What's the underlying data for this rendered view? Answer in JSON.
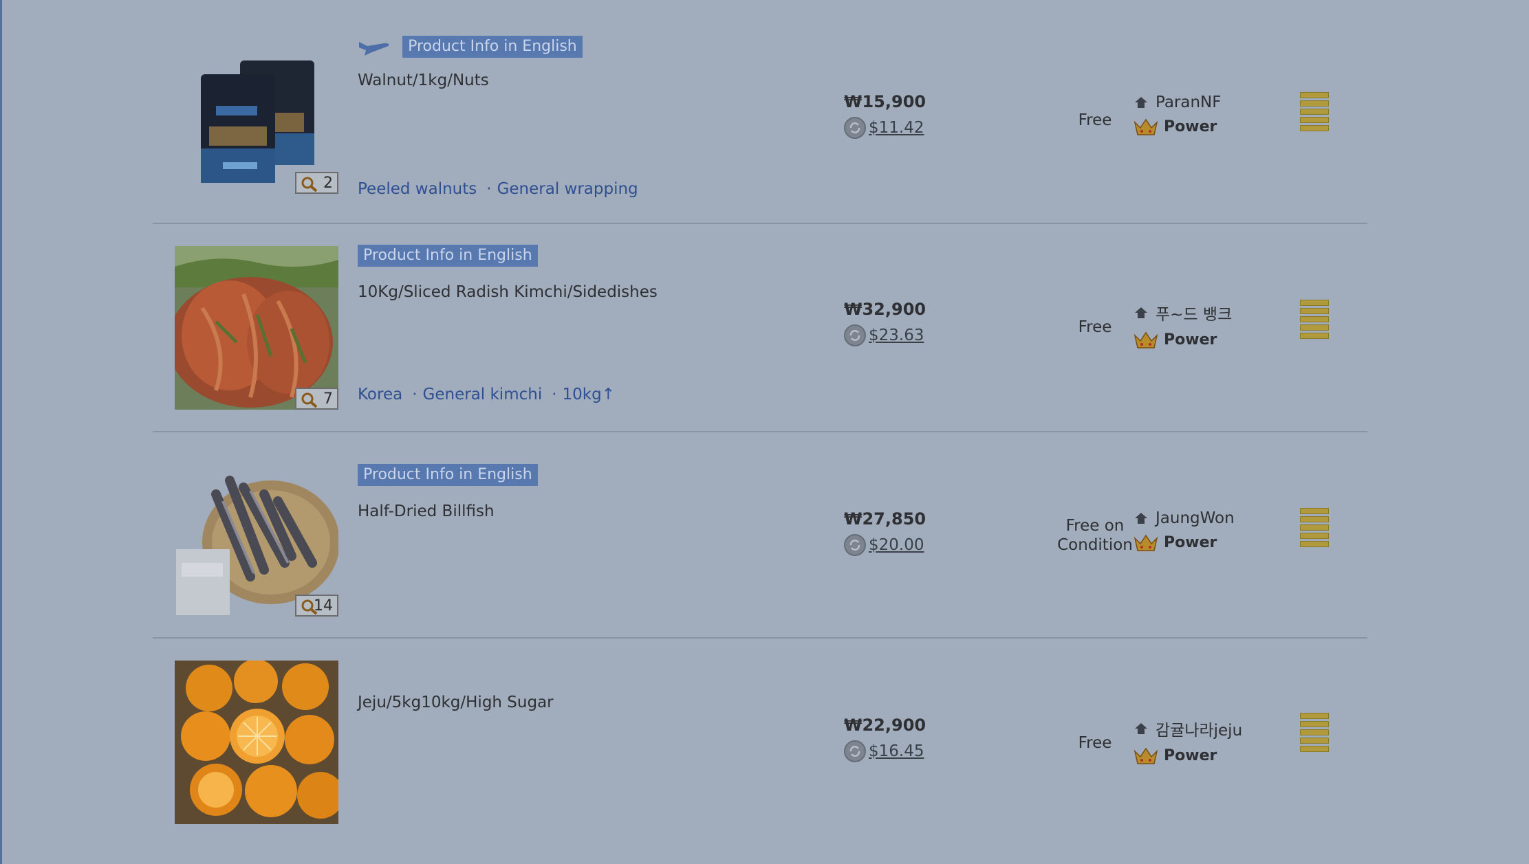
{
  "products": [
    {
      "english_tag": "Product Info in English",
      "has_overseas_icon": true,
      "name": "Walnut/1kg/Nuts",
      "attributes": [
        "Peeled walnuts",
        "General wrapping"
      ],
      "zoom_count": "2",
      "price_krw": "₩15,900",
      "price_usd": "$11.42",
      "shipping": "Free",
      "seller": "ParanNF",
      "seller_grade": "Power"
    },
    {
      "english_tag": "Product Info in English",
      "has_overseas_icon": false,
      "name": "10Kg/Sliced Radish Kimchi/Sidedishes",
      "attributes": [
        "Korea",
        "General kimchi",
        "10kg↑"
      ],
      "zoom_count": "7",
      "price_krw": "₩32,900",
      "price_usd": "$23.63",
      "shipping": "Free",
      "seller": "푸~드 뱅크",
      "seller_grade": "Power"
    },
    {
      "english_tag": "Product Info in English",
      "has_overseas_icon": false,
      "name": "Half-Dried Billfish",
      "attributes": [],
      "zoom_count": "14",
      "price_krw": "₩27,850",
      "price_usd": "$20.00",
      "shipping": "Free on Condition",
      "seller": "JaungWon",
      "seller_grade": "Power"
    },
    {
      "english_tag": "",
      "has_overseas_icon": false,
      "name": "Jeju/5kg10kg/High Sugar",
      "attributes": [],
      "zoom_count": "",
      "price_krw": "₩22,900",
      "price_usd": "$16.45",
      "shipping": "Free",
      "seller": "감귤나라jeju",
      "seller_grade": "Power"
    }
  ],
  "colors": {
    "overlay_bg": "#a1adbc",
    "tag_bg": "#5878b0",
    "link": "#2f4f93",
    "stack_gold": "#b09a3c"
  }
}
